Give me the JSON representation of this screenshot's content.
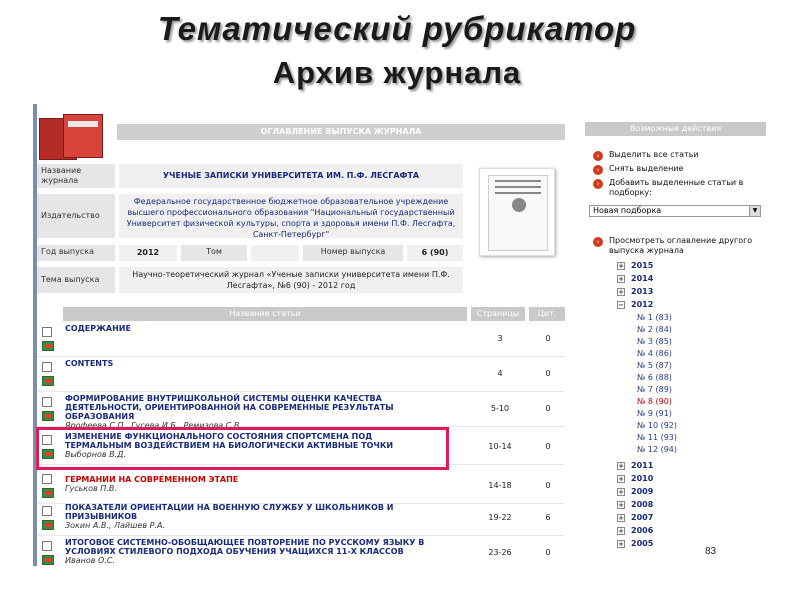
{
  "slide": {
    "title": "Тематический рубрикатор",
    "subtitle": "Архив журнала",
    "page_number": "83"
  },
  "journal": {
    "header": "ОГЛАВЛЕНИЕ ВЫПУСКА ЖУРНАЛА",
    "name_label": "Название журнала",
    "name_value": "УЧЕНЫЕ ЗАПИСКИ УНИВЕРСИТЕТА ИМ. П.Ф. ЛЕСГАФТА",
    "publisher_label": "Издательство",
    "publisher_value": "Федеральное государственное бюджетное образовательное учреждение высшего профессионального образования \"Национальный государственный Университет физической культуры, спорта и здоровья имени П.Ф. Лесгафта, Санкт-Петербург\"",
    "year_label": "Год выпуска",
    "year_value": "2012",
    "volume_label": "Том",
    "issue_label": "Номер выпуска",
    "issue_value": "6 (90)",
    "issue_title_label": "Тема выпуска",
    "issue_title_value": "Научно-теоретический журнал «Ученые записки университета имени П.Ф. Лесгафта», №6 (90) - 2012 год"
  },
  "table": {
    "col_title": "Название статьи",
    "col_pages": "Страницы",
    "col_cit": "Цит.",
    "rows": [
      {
        "title": "СОДЕРЖАНИЕ",
        "authors": "",
        "pages": "3",
        "cit": "0"
      },
      {
        "title": "CONTENTS",
        "authors": "",
        "pages": "4",
        "cit": "0"
      },
      {
        "title": "ФОРМИРОВАНИЕ ВНУТРИШКОЛЬНОЙ СИСТЕМЫ ОЦЕНКИ КАЧЕСТВА ДЕЯТЕЛЬНОСТИ, ОРИЕНТИРОВАННОЙ НА СОВРЕМЕННЫЕ РЕЗУЛЬТАТЫ ОБРАЗОВАНИЯ",
        "authors": "Ярофеева С.П., Гусева И.Б., Ремизова С.В.",
        "pages": "5-10",
        "cit": "0"
      },
      {
        "title": "ИЗМЕНЕНИЕ ФУНКЦИОНАЛЬНОГО СОСТОЯНИЯ СПОРТСМЕНА ПОД ТЕРМАЛЬНЫМ ВОЗДЕЙСТВИЕМ НА БИОЛОГИЧЕСКИ АКТИВНЫЕ ТОЧКИ",
        "authors": "Выборнов В.Д.",
        "pages": "10-14",
        "cit": "0"
      },
      {
        "title": "ГЕРМАНИИ НА СОВРЕМЕННОМ ЭТАПЕ",
        "authors": "Гуськов П.В.",
        "pages": "14-18",
        "cit": "0"
      },
      {
        "title": "ПОКАЗАТЕЛИ ОРИЕНТАЦИИ НА ВОЕННУЮ СЛУЖБУ У ШКОЛЬНИКОВ И ПРИЗЫВНИКОВ",
        "authors": "Зокин А.В., Лайшев Р.А.",
        "pages": "19-22",
        "cit": "6"
      },
      {
        "title": "ИТОГОВОЕ СИСТЕМНО-ОБОБЩАЮЩЕЕ ПОВТОРЕНИЕ ПО РУССКОМУ ЯЗЫКУ В УСЛОВИЯХ СТИЛЕВОГО ПОДХОДА ОБУЧЕНИЯ УЧАЩИХСЯ 11-Х КЛАССОВ",
        "authors": "Иванов О.С.",
        "pages": "23-26",
        "cit": "0"
      }
    ]
  },
  "actions": {
    "header": "Возможные действия",
    "select_all": "Выделить все статьи",
    "clear_selection": "Снять выделение",
    "add_selected": "Добавить выделенные статьи в подборку:",
    "selection_value": "Новая подборка",
    "view_other": "Просмотреть оглавление другого выпуска журнала"
  },
  "archive": {
    "years_top": [
      {
        "year": "2015",
        "sign": "+"
      },
      {
        "year": "2014",
        "sign": "+"
      },
      {
        "year": "2013",
        "sign": "+"
      },
      {
        "year": "2012",
        "sign": "−"
      }
    ],
    "issues": [
      "№ 1 (83)",
      "№ 2 (84)",
      "№ 3 (85)",
      "№ 4 (86)",
      "№ 5 (87)",
      "№ 6 (88)",
      "№ 7 (89)",
      "№ 8 (90)",
      "№ 9 (91)",
      "№ 10 (92)",
      "№ 11 (93)",
      "№ 12 (94)"
    ],
    "current_issue": "№ 8 (90)",
    "years_bottom": [
      {
        "year": "2011",
        "sign": "+"
      },
      {
        "year": "2010",
        "sign": "+"
      },
      {
        "year": "2009",
        "sign": "+"
      },
      {
        "year": "2008",
        "sign": "+"
      },
      {
        "year": "2007",
        "sign": "+"
      },
      {
        "year": "2006",
        "sign": "+"
      },
      {
        "year": "2005",
        "sign": "+"
      }
    ]
  },
  "colors": {
    "highlight": "#e0195a",
    "bullet": "#d13a1c",
    "link": "#1a2a7a"
  }
}
